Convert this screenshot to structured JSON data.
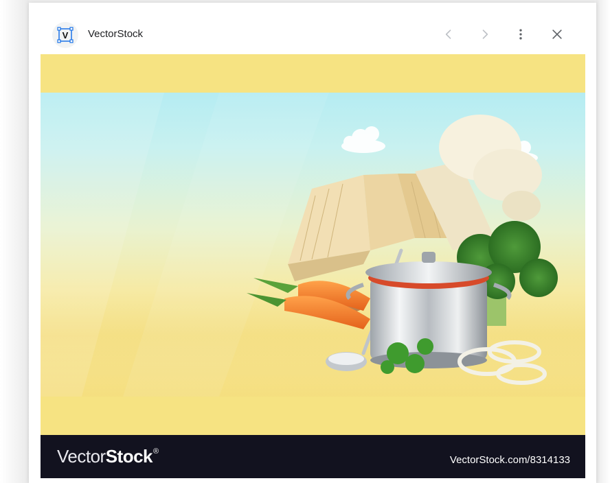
{
  "header": {
    "source_name": "VectorStock",
    "logo_letter": "V",
    "prev_icon": "chevron-left-icon",
    "next_icon": "chevron-right-icon",
    "more_icon": "more-vert-icon",
    "close_icon": "close-icon"
  },
  "image": {
    "watermark_brand_light": "Vector",
    "watermark_brand_bold": "Stock",
    "watermark_registered": "®",
    "watermark_url": "VectorStock.com/8314133"
  },
  "colors": {
    "band_yellow": "#f6e382",
    "watermark_bar": "#12121f",
    "header_text": "#202124",
    "icon_gray": "#5f6368",
    "icon_disabled": "#bdc1c6"
  }
}
